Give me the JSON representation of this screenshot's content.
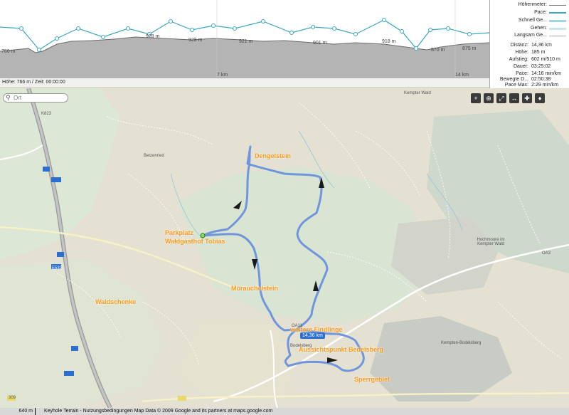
{
  "elevation": {
    "labels": [
      "766 m",
      "928 m",
      "928 m",
      "921 m",
      "901 m",
      "918 m",
      "870 m",
      "875 m"
    ],
    "km_labels": [
      "7 km",
      "14 km"
    ],
    "info": "Höhe: 766 m / Zeit: 00:00:00"
  },
  "legend": [
    {
      "label": "Höhenmeter:"
    },
    {
      "label": "Pace:"
    },
    {
      "label": "Schnell Ge..."
    },
    {
      "label": "Gehen:"
    },
    {
      "label": "Langsam Ge..."
    }
  ],
  "stats": [
    {
      "label": "Distanz:",
      "value": "14,36 km"
    },
    {
      "label": "Höhe:",
      "value": "185 m"
    },
    {
      "label": "Aufstieg:",
      "value": "602 m/510 m"
    },
    {
      "label": "Dauer:",
      "value": "03:25:02"
    },
    {
      "label": "Pace:",
      "value": "14:16 min/km"
    },
    {
      "label": "Bewegte D...",
      "value": "02:50:38"
    },
    {
      "label": "Pace Max:",
      "value": "2:29 min/km"
    }
  ],
  "search": {
    "placeholder": "Ort"
  },
  "toolbar": [
    "+",
    "⊕",
    "⤢",
    "↔",
    "✚",
    "♦"
  ],
  "pois": [
    {
      "label": "Dengelstein"
    },
    {
      "label": "Parkplatz"
    },
    {
      "label": "Waldgasthof Tobias"
    },
    {
      "label": "Morauchelstein"
    },
    {
      "label": "Waldschenke"
    },
    {
      "label": "weitere Findlinge"
    },
    {
      "label": "Aussichtspunkt Bedelsberg"
    },
    {
      "label": "Sperrgebiet"
    }
  ],
  "places": [
    {
      "label": "Kempter Wald"
    },
    {
      "label": "Betzenried"
    },
    {
      "label": "Hochmoore im Kempter Wald"
    },
    {
      "label": "Kempten-Bodelsberg"
    },
    {
      "label": "Bodelsberg"
    },
    {
      "label": "OA11"
    },
    {
      "label": "OA3"
    },
    {
      "label": "E532"
    },
    {
      "label": "K823"
    },
    {
      "label": "309"
    }
  ],
  "badge": "14,36 km",
  "footer": {
    "scale": "640 m",
    "text": "Keyhole Terrain - Nutzungsbedingungen Map Data © 2009 Google and its partners at maps.google.com"
  }
}
